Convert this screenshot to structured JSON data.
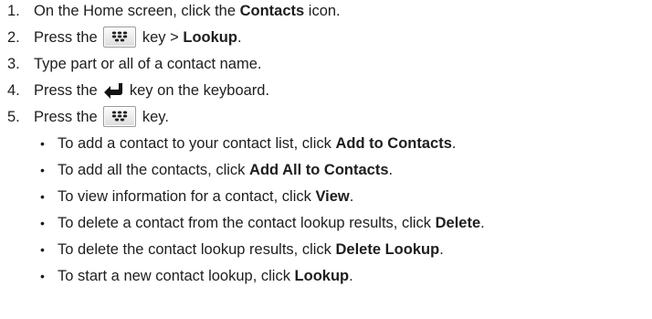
{
  "steps": [
    {
      "num": "1.",
      "pre": "On the Home screen, click the ",
      "bold": "Contacts",
      "post": " icon."
    },
    {
      "num": "2.",
      "pre": "Press the ",
      "icon": "blackberry-menu-key-icon",
      "mid": " key > ",
      "bold": "Lookup",
      "post": "."
    },
    {
      "num": "3.",
      "text": "Type part or all of a contact name."
    },
    {
      "num": "4.",
      "pre": "Press the ",
      "icon": "enter-key-icon",
      "post": " key on the keyboard."
    },
    {
      "num": "5.",
      "pre": "Press the ",
      "icon": "blackberry-menu-key-icon",
      "post": " key."
    }
  ],
  "bullets": [
    {
      "pre": "To add a contact to your contact list, click ",
      "bold": "Add to Contacts",
      "post": "."
    },
    {
      "pre": "To add all the contacts, click ",
      "bold": "Add All to Contacts",
      "post": "."
    },
    {
      "pre": "To view information for a contact, click ",
      "bold": "View",
      "post": "."
    },
    {
      "pre": "To delete a contact from the contact lookup results, click ",
      "bold": "Delete",
      "post": "."
    },
    {
      "pre": "To delete the contact lookup results, click ",
      "bold": "Delete Lookup",
      "post": "."
    },
    {
      "pre": "To start a new contact lookup, click ",
      "bold": "Lookup",
      "post": "."
    }
  ],
  "bullet_glyph": "•"
}
